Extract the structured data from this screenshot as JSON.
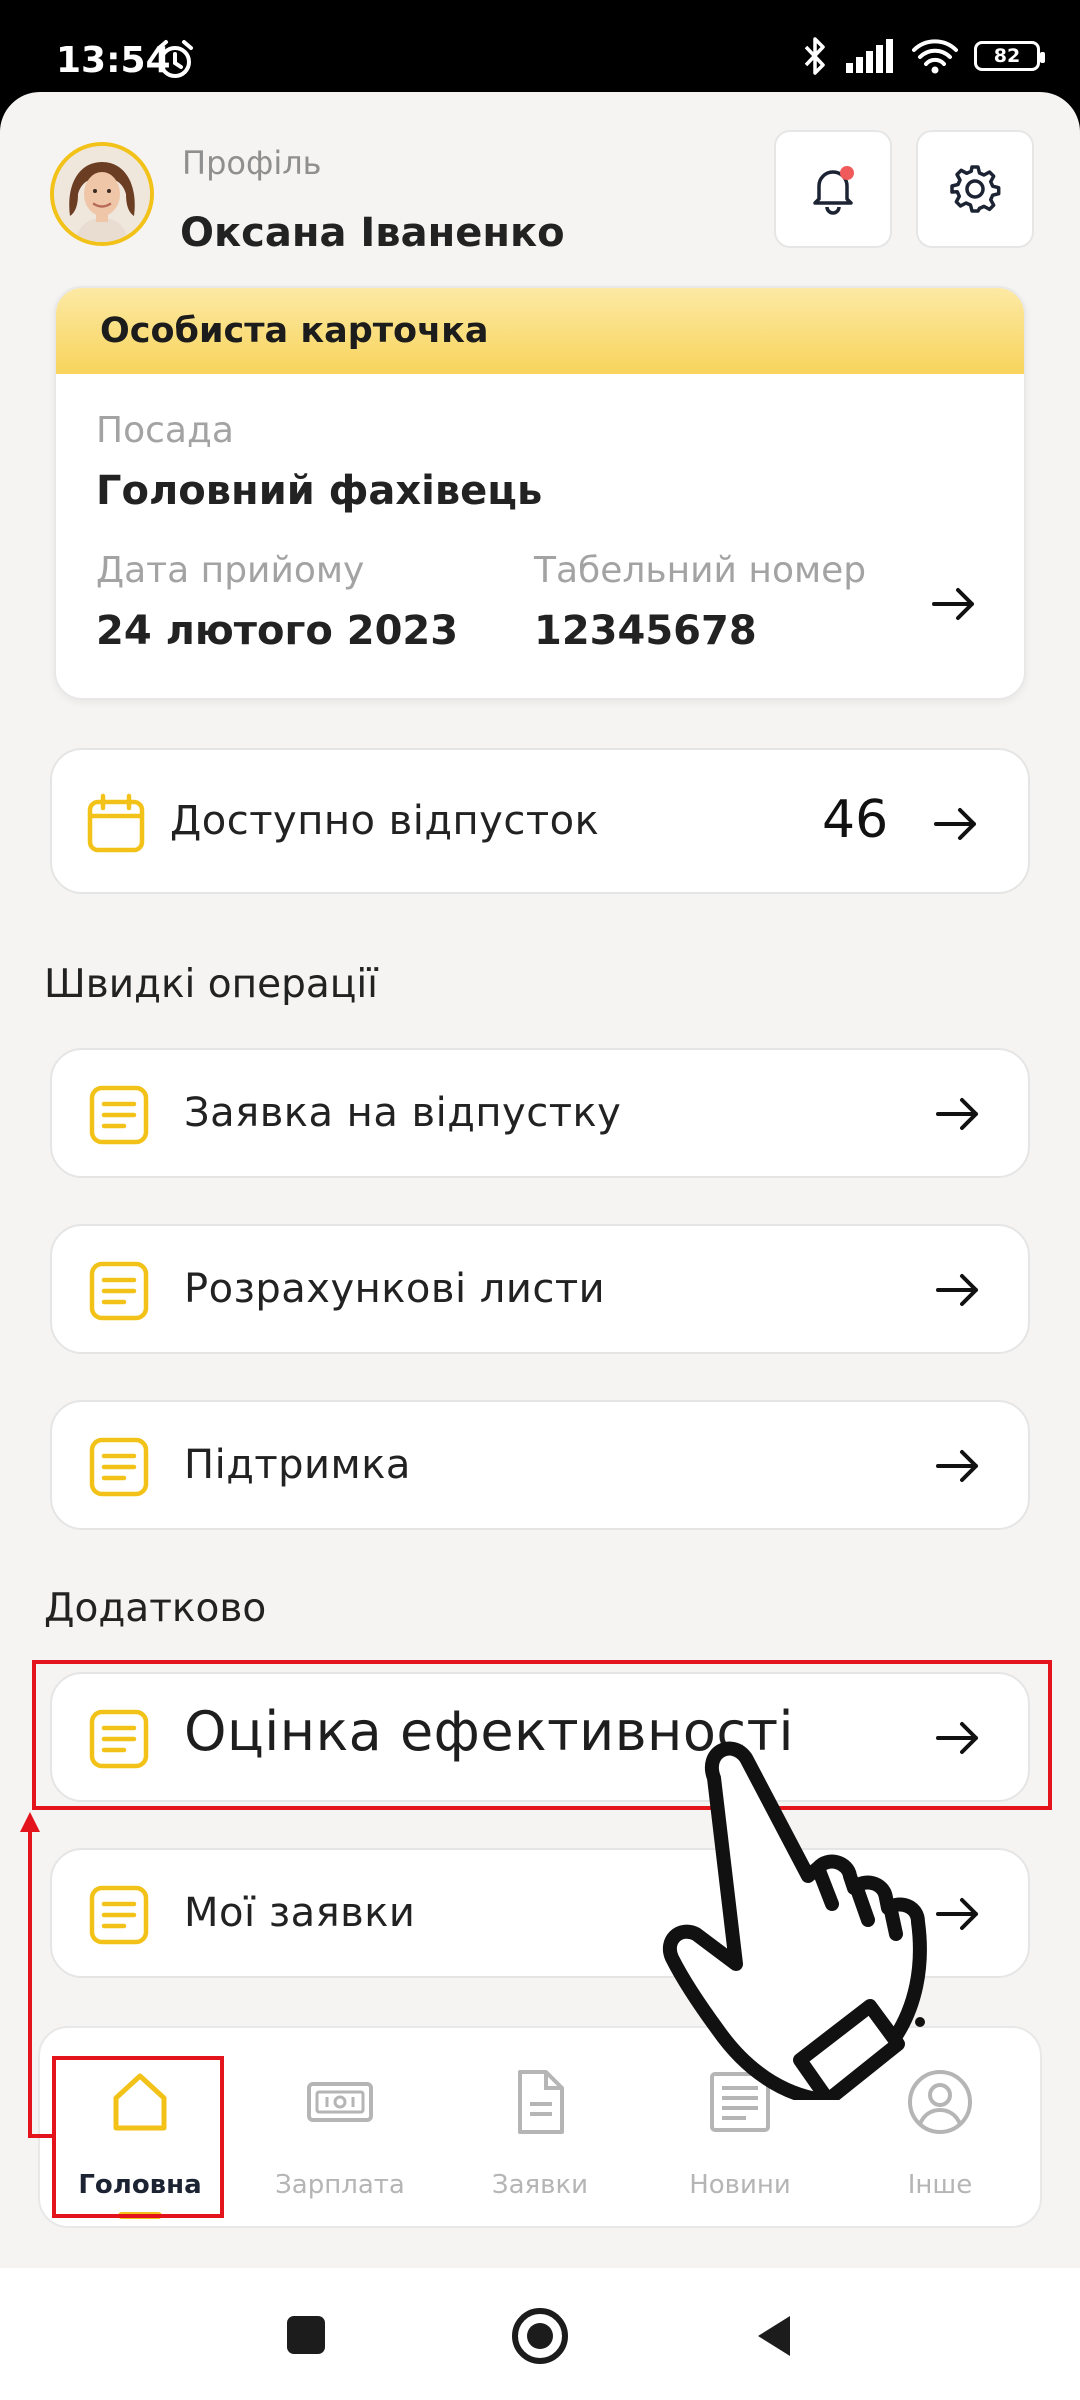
{
  "status_bar": {
    "time": "13:54",
    "battery": "82"
  },
  "profile": {
    "label": "Профіль",
    "name": "Оксана Іваненко"
  },
  "personal_card": {
    "title": "Особиста карточка",
    "position_label": "Посада",
    "position_value": "Головний фахівець",
    "hire_date_label": "Дата прийому",
    "hire_date_value": "24 лютого 2023",
    "tab_number_label": "Табельний номер",
    "tab_number_value": "12345678"
  },
  "vacation": {
    "label": "Доступно відпусток",
    "count": "46"
  },
  "quick_ops": {
    "title": "Швидкі операції",
    "items": [
      "Заявка на відпустку",
      "Розрахункові листи",
      "Підтримка"
    ]
  },
  "additional": {
    "title": "Додатково",
    "items": [
      "Оцінка ефективності",
      "Мої заявки"
    ]
  },
  "bottom_nav": {
    "items": [
      {
        "label": "Головна",
        "icon": "home-icon",
        "active": true
      },
      {
        "label": "Зарплата",
        "icon": "money-icon",
        "active": false
      },
      {
        "label": "Заявки",
        "icon": "document-icon",
        "active": false
      },
      {
        "label": "Новини",
        "icon": "news-icon",
        "active": false
      },
      {
        "label": "Інше",
        "icon": "user-circle-icon",
        "active": false
      }
    ]
  },
  "colors": {
    "accent": "#f2c218",
    "highlight": "#e3141c",
    "notification_dot": "#f05a5a"
  }
}
